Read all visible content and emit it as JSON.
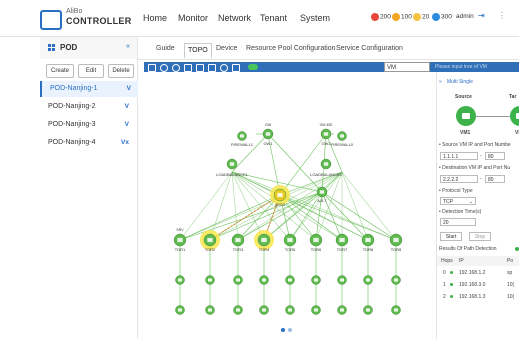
{
  "header": {
    "logo_sub": "AliBo",
    "logo_main": "CONTROLLER",
    "nav": [
      "Home",
      "Monitor",
      "Network",
      "Tenant",
      "System"
    ],
    "alerts": [
      {
        "value": "200",
        "color": "#e8473b"
      },
      {
        "value": "100",
        "color": "#f3a623"
      },
      {
        "value": "20",
        "color": "#f5c342"
      },
      {
        "value": "300",
        "color": "#2b8bde"
      }
    ],
    "user": "admin"
  },
  "sidebar": {
    "title": "POD",
    "collapse": "«",
    "buttons": [
      "Create",
      "Edit",
      "Delete"
    ],
    "items": [
      {
        "label": "POD-Nanjing-1",
        "indicator": "V"
      },
      {
        "label": "POD-Nanjing-2",
        "indicator": "V"
      },
      {
        "label": "POD-Nanjing-3",
        "indicator": "V"
      },
      {
        "label": "POD-Nanjing-4",
        "indicator": "Vx"
      }
    ],
    "active_index": 0
  },
  "tabs": [
    "Guide",
    "TOPO",
    "Device",
    "Resource Pool Configuration",
    "Service Configuration"
  ],
  "active_tab": 1,
  "search": {
    "value": "VM",
    "placeholder": "Please input tree of VM"
  },
  "topology": {
    "top_labels": {
      "gw1_top": "GW",
      "gw2_top": "GW IDE",
      "fw1": "FIREWALL1",
      "gw1": "GW1",
      "gw2": "GW2",
      "fw0": "FIREWALL0",
      "lb1": "LOADBALANCE1",
      "lb0": "LOADBALANCE0",
      "spine_a": "ARCG",
      "spine_b": "A-B-T"
    },
    "tors": [
      "TOR1",
      "TOR2",
      "TOR3",
      "TOR4",
      "TOR5",
      "TOR6",
      "TOR7",
      "TOR8",
      "TOR8"
    ],
    "tor_top": "SRV"
  },
  "panel": {
    "title": "Multi  Single",
    "source": "Source",
    "target": "Tar",
    "vm1": "VM1",
    "vm2": "VM",
    "src_label": "• Source VM IP and Port Numbe",
    "src_ip": "1.1.1.1",
    "src_port": "80",
    "dst_label": "• Destination VM IP and Port Nu",
    "dst_ip": "2.2.2.2",
    "dst_port": "80",
    "proto_label": "• Protocol Type",
    "proto": "TCP",
    "time_label": "• Detection Time(s)",
    "time": "20",
    "start": "Start",
    "stop": "Stop",
    "results_label": "Results Of Path Detection",
    "col_hops": "Hops",
    "col_ip": "IP",
    "col_port": "Po",
    "rows": [
      {
        "hop": "0",
        "ip": "192.168.1.2",
        "port": "sp"
      },
      {
        "hop": "1",
        "ip": "192.168.3.0",
        "port": "10("
      },
      {
        "hop": "2",
        "ip": "192.168.1.3",
        "port": "10("
      }
    ]
  }
}
